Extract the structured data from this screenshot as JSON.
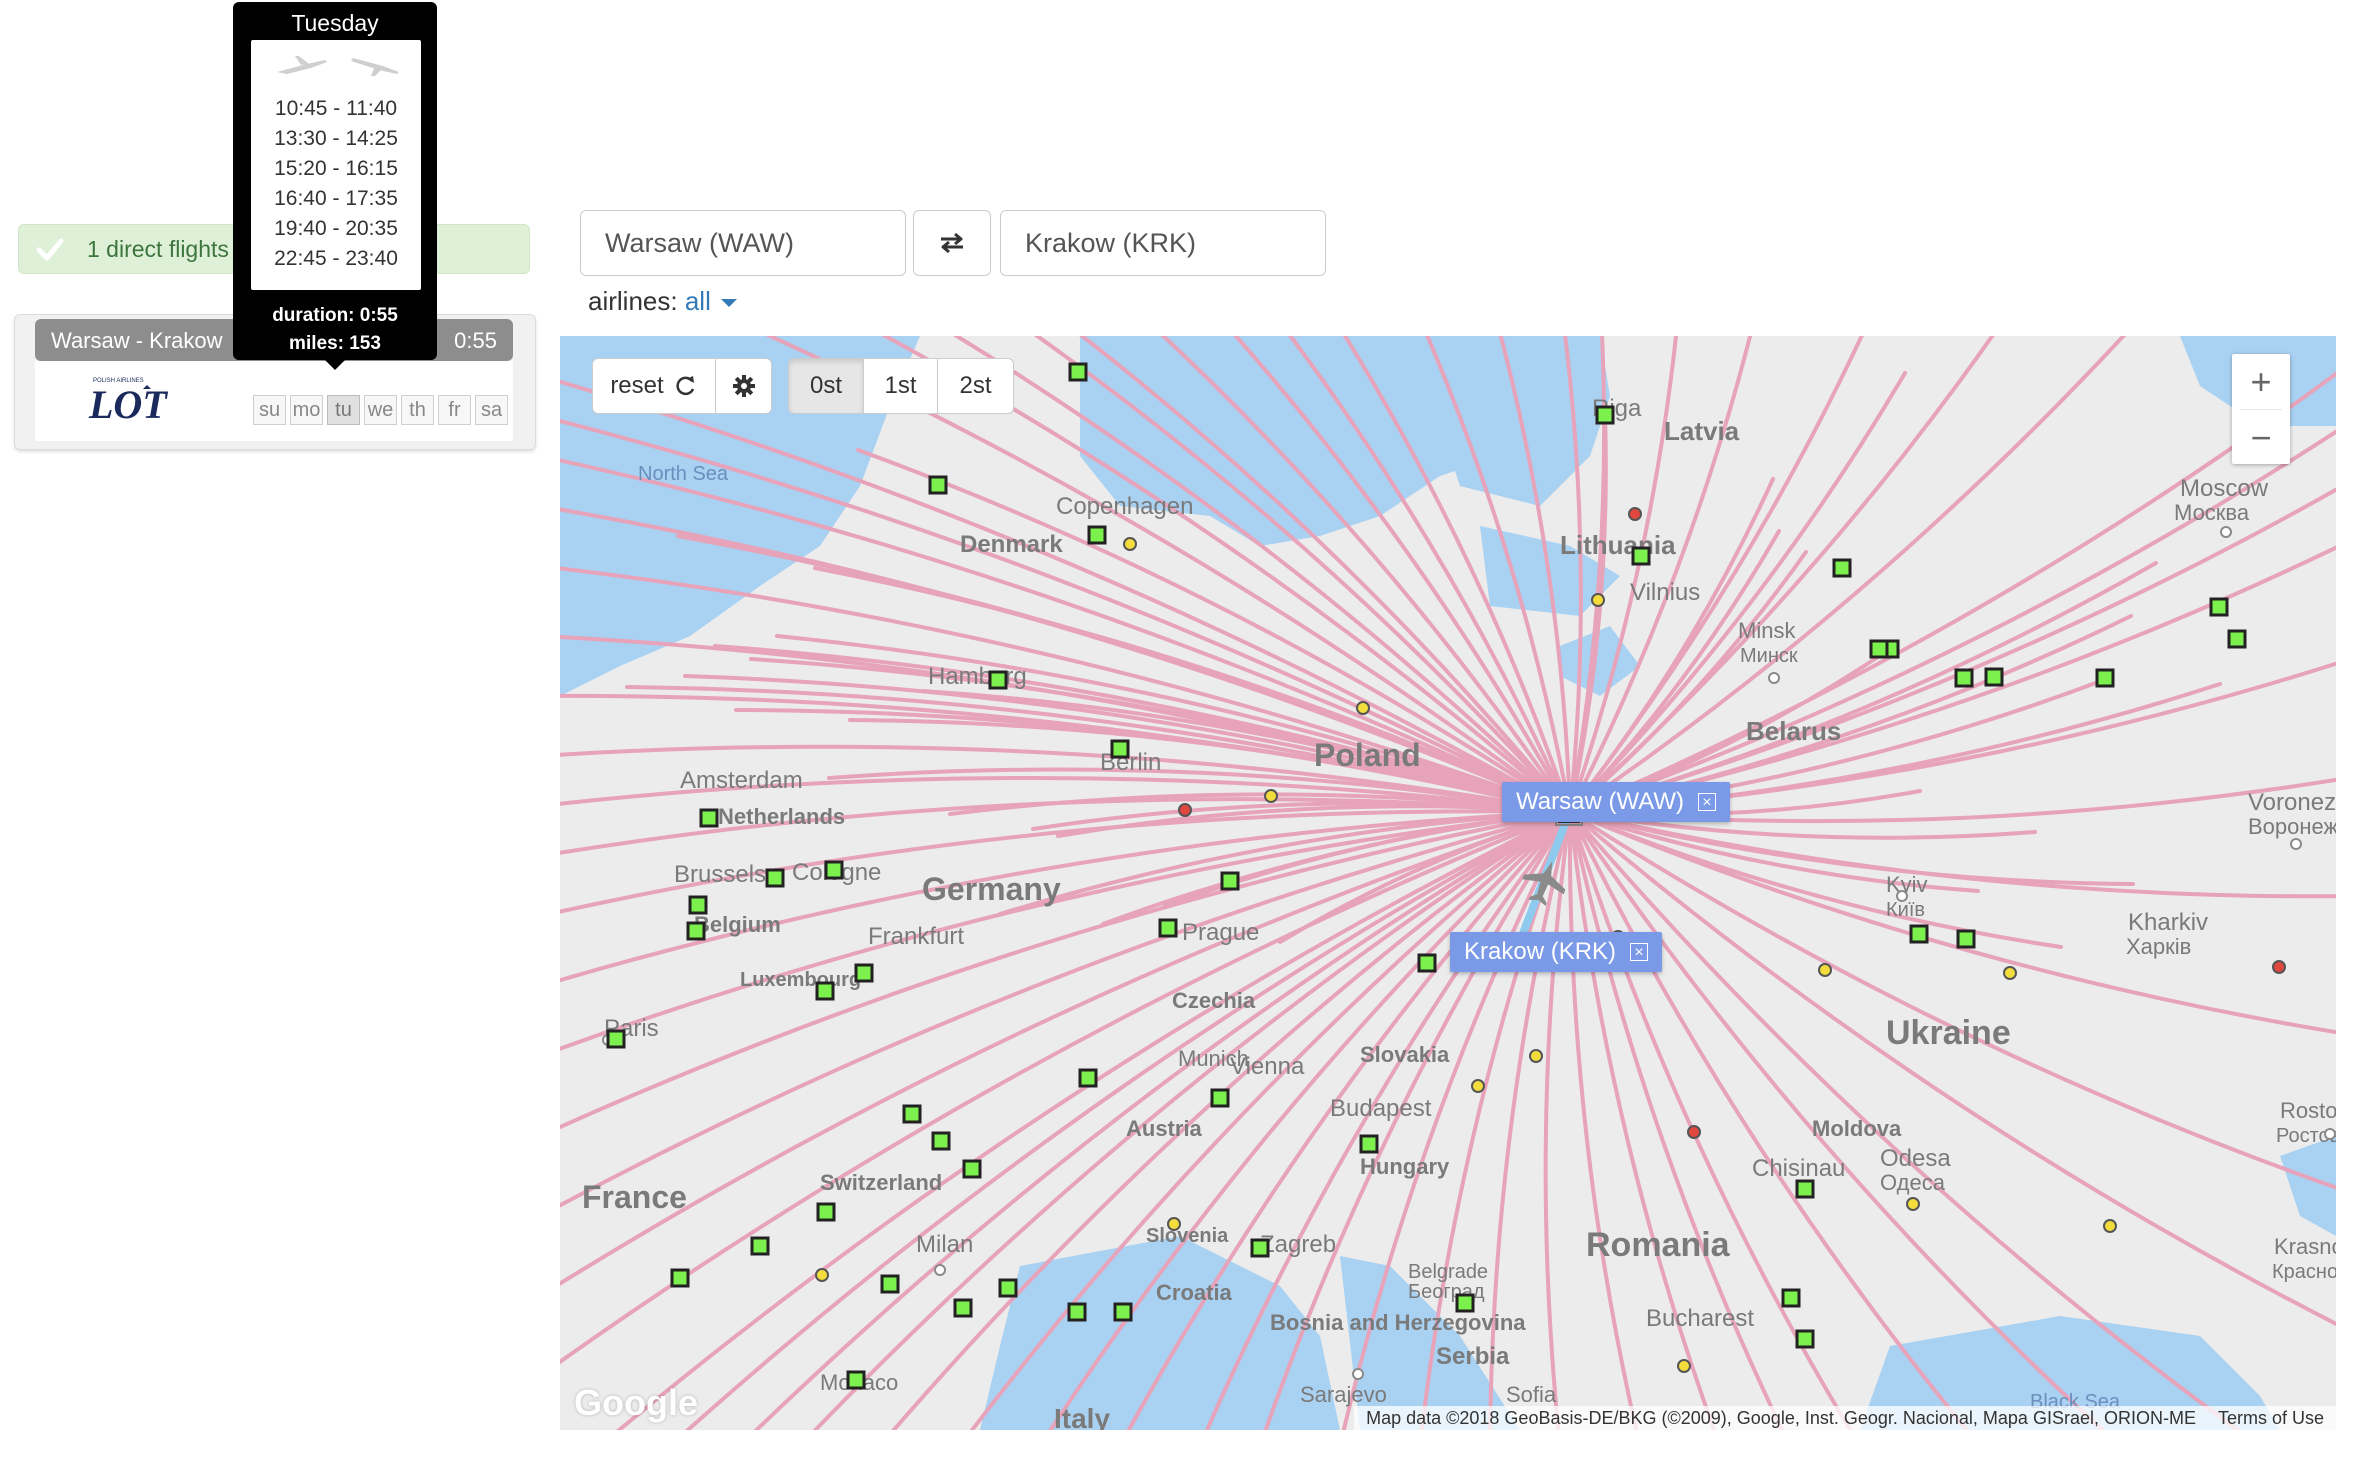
{
  "results": {
    "alert_text": "1 direct flights",
    "route": "Warsaw - Krakow",
    "duration": "0:55",
    "logo_alt": "LOT",
    "logo_small": "POLISH AIRLINES",
    "days": [
      "su",
      "mo",
      "tu",
      "we",
      "th",
      "fr",
      "sa"
    ],
    "active_day": "tu"
  },
  "tooltip": {
    "day": "Tuesday",
    "times": [
      "10:45 - 11:40",
      "13:30 - 14:25",
      "15:20 - 16:15",
      "16:40 - 17:35",
      "19:40 - 20:35",
      "22:45 - 23:40"
    ],
    "duration": "duration: 0:55",
    "miles": "miles: 153"
  },
  "search": {
    "from": "Warsaw (WAW)",
    "to": "Krakow (KRK)",
    "airlines_label": "airlines:",
    "airlines_value": "all"
  },
  "map": {
    "reset_label": "reset",
    "stops": [
      "0st",
      "1st",
      "2st"
    ],
    "active_stop": "0st",
    "zoom_in": "+",
    "zoom_out": "−",
    "origin_label": "Warsaw (WAW)",
    "destination_label": "Krakow (KRK)",
    "close_glyph": "×",
    "attribution": "Map data ©2018 GeoBasis-DE/BKG (©2009), Google, Inst. Geogr. Nacional, Mapa GISrael, ORION-ME",
    "terms": "Terms of Use",
    "google_logo": "Google",
    "colors": {
      "route": "#e7a3b9",
      "selected_route": "#8ec9ee",
      "airport": "#7cf04c",
      "land": "#ececec",
      "water": "#a9d1f2"
    },
    "place_names": [
      "North Sea",
      "Denmark",
      "Copenhagen",
      "Hamburg",
      "Amsterdam",
      "Netherlands",
      "Brussels",
      "Cologne",
      "Belgium",
      "Luxembourg",
      "Paris",
      "Germany",
      "Frankfurt",
      "Berlin",
      "Poland",
      "Riga",
      "Latvia",
      "Lithuania",
      "Vilnius",
      "Minsk",
      "Минск",
      "Belarus",
      "Moscow",
      "Москва",
      "Voronezh",
      "Воронеж",
      "Kyiv",
      "Київ",
      "Kharkiv",
      "Харків",
      "Ukraine",
      "Czechia",
      "Prague",
      "Slovakia",
      "Vienna",
      "Austria",
      "Budapest",
      "Hungary",
      "Moldova",
      "Chisinau",
      "Odesa",
      "Одеса",
      "Rostov-on-Don",
      "Ростов-на-Дону",
      "Switzerland",
      "Milan",
      "Monaco",
      "France",
      "Slovenia",
      "Zagreb",
      "Croatia",
      "Belgrade",
      "Београд",
      "Bosnia and Herzegovina",
      "Sarajevo",
      "Serbia",
      "Romania",
      "Bucharest",
      "Sofia",
      "Italy",
      "Black Sea",
      "Krasnodar",
      "Краснодар",
      "Munich"
    ]
  }
}
